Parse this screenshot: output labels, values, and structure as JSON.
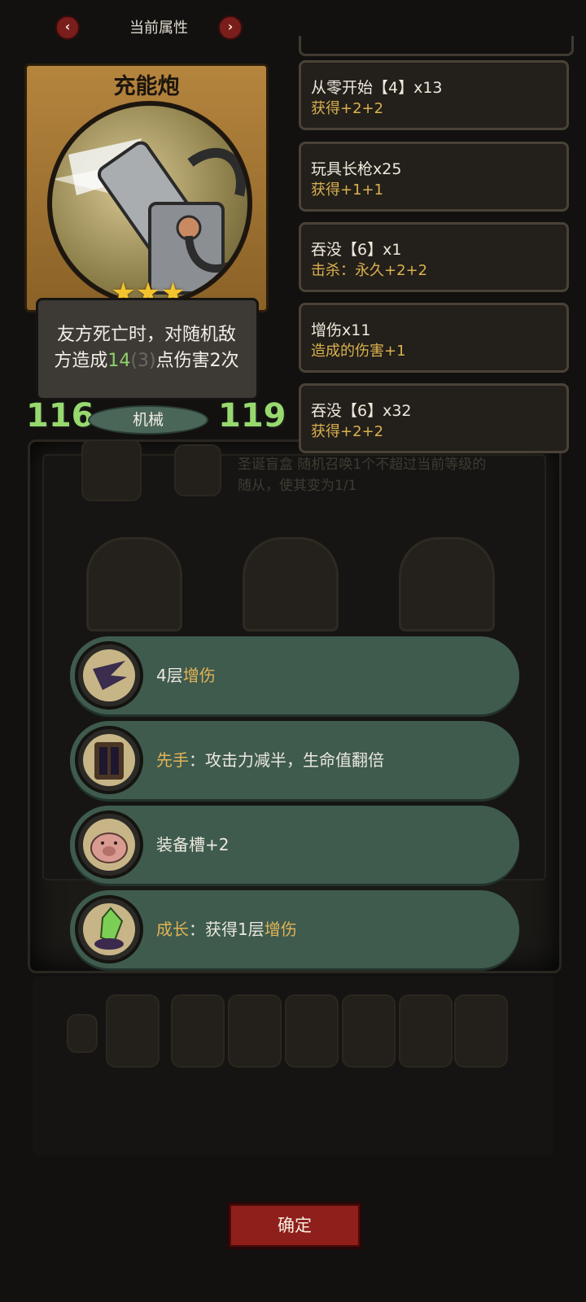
{
  "header": {
    "title": "当前属性",
    "prev_icon": "chevron-left-icon",
    "next_icon": "chevron-right-icon"
  },
  "card": {
    "name": "充能炮",
    "stars": 3,
    "desc_line1": "友方死亡时，对随机敌",
    "desc_line2_prefix": "方造成",
    "desc_damage": "14",
    "desc_damage_base": "(3)",
    "desc_line2_suffix": "点伤害2次",
    "attack": "116",
    "health": "119",
    "tribe": "机械",
    "colors": {
      "stat": "#97d96e",
      "frame": "#b5853e",
      "star": "#f2c32c"
    }
  },
  "attributes": [
    {
      "name": "从零开始【4】x13",
      "effect": "获得+2+2"
    },
    {
      "name": "玩具长枪x25",
      "effect": "获得+1+1"
    },
    {
      "name": "吞没【6】x1",
      "effect": "击杀：永久+2+2"
    },
    {
      "name": "增伤x11",
      "effect": "造成的伤害+1"
    },
    {
      "name": "吞没【6】x32",
      "effect": "获得+2+2"
    }
  ],
  "background": {
    "ghost_line1": "圣诞盲盒 随机召唤1个不超过当前等级的",
    "ghost_line2": "随从，使其变为1/1"
  },
  "buffs": [
    {
      "icon": "wing-icon",
      "prefix": "",
      "prefix_sep": "",
      "text": "4层",
      "highlight": "增伤"
    },
    {
      "icon": "armor-icon",
      "prefix": "先手",
      "prefix_sep": "：",
      "text": "攻击力减半，生命值翻倍",
      "highlight": ""
    },
    {
      "icon": "pig-icon",
      "prefix": "",
      "prefix_sep": "",
      "text": "装备槽+2",
      "highlight": ""
    },
    {
      "icon": "crystal-icon",
      "prefix": "成长",
      "prefix_sep": "：",
      "text": "获得1层",
      "highlight": "增伤"
    }
  ],
  "confirm_label": "确定"
}
